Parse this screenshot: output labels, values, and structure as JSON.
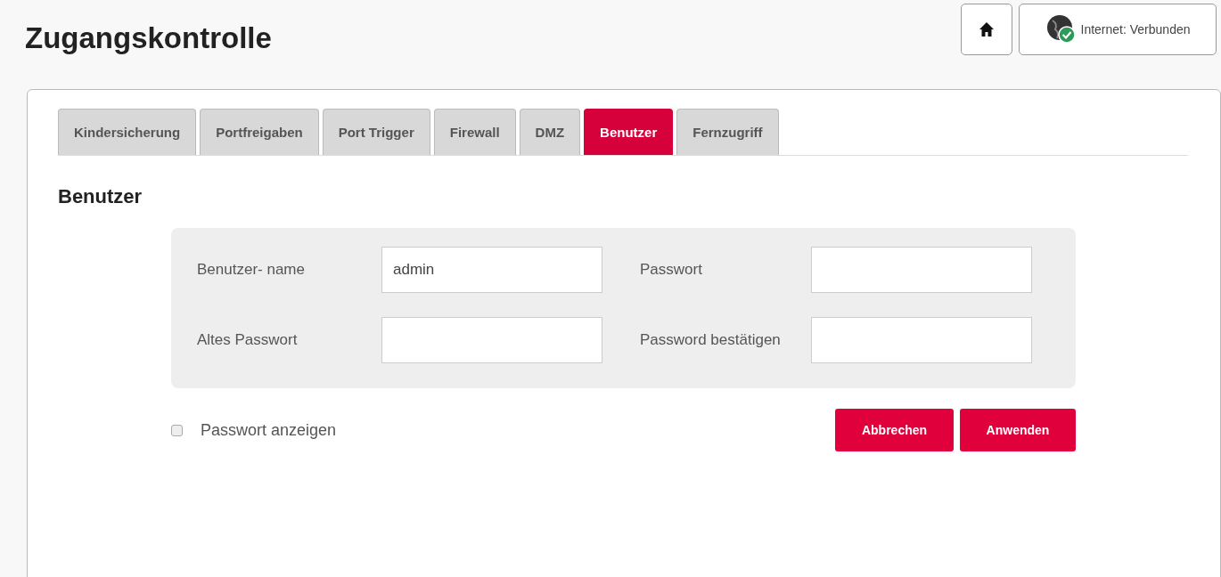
{
  "page_title": "Zugangskontrolle",
  "header": {
    "status_label": "Internet:",
    "status_value": "Verbunden"
  },
  "tabs": [
    {
      "label": "Kindersicherung",
      "selected": false
    },
    {
      "label": "Portfreigaben",
      "selected": false
    },
    {
      "label": "Port Trigger",
      "selected": false
    },
    {
      "label": "Firewall",
      "selected": false
    },
    {
      "label": "DMZ",
      "selected": false
    },
    {
      "label": "Benutzer",
      "selected": true
    },
    {
      "label": "Fernzugriff",
      "selected": false
    }
  ],
  "section_title": "Benutzer",
  "fields": [
    {
      "label": "Benutzer- name",
      "value": "admin"
    },
    {
      "label": "Passwort"
    },
    {
      "label": "Altes Passwort"
    },
    {
      "label": "Password bestätigen"
    }
  ],
  "show_password": {
    "label": "Passwort anzeigen",
    "checked": false
  },
  "buttons": [
    "Abbrechen",
    "Anwenden"
  ]
}
